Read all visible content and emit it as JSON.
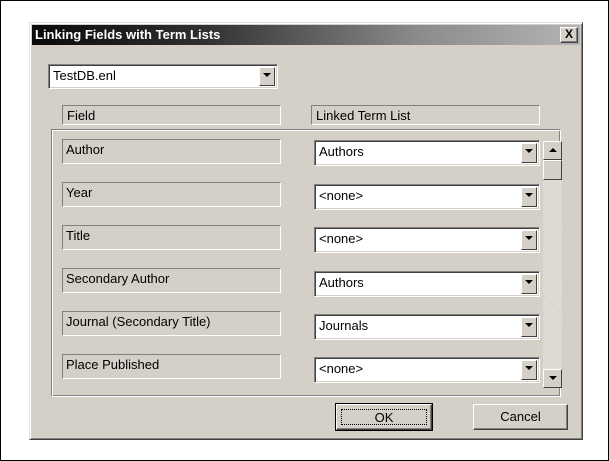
{
  "dialog": {
    "title": "Linking Fields with Term Lists",
    "close_label": "X"
  },
  "library_select": {
    "value": "TestDB.enl"
  },
  "headers": {
    "field": "Field",
    "linked": "Linked Term List"
  },
  "rows": [
    {
      "field": "Author",
      "term_list": "Authors"
    },
    {
      "field": "Year",
      "term_list": "<none>"
    },
    {
      "field": "Title",
      "term_list": "<none>"
    },
    {
      "field": "Secondary Author",
      "term_list": "Authors"
    },
    {
      "field": "Journal (Secondary Title)",
      "term_list": "Journals"
    },
    {
      "field": "Place Published",
      "term_list": "<none>"
    }
  ],
  "buttons": {
    "ok": "OK",
    "cancel": "Cancel"
  }
}
